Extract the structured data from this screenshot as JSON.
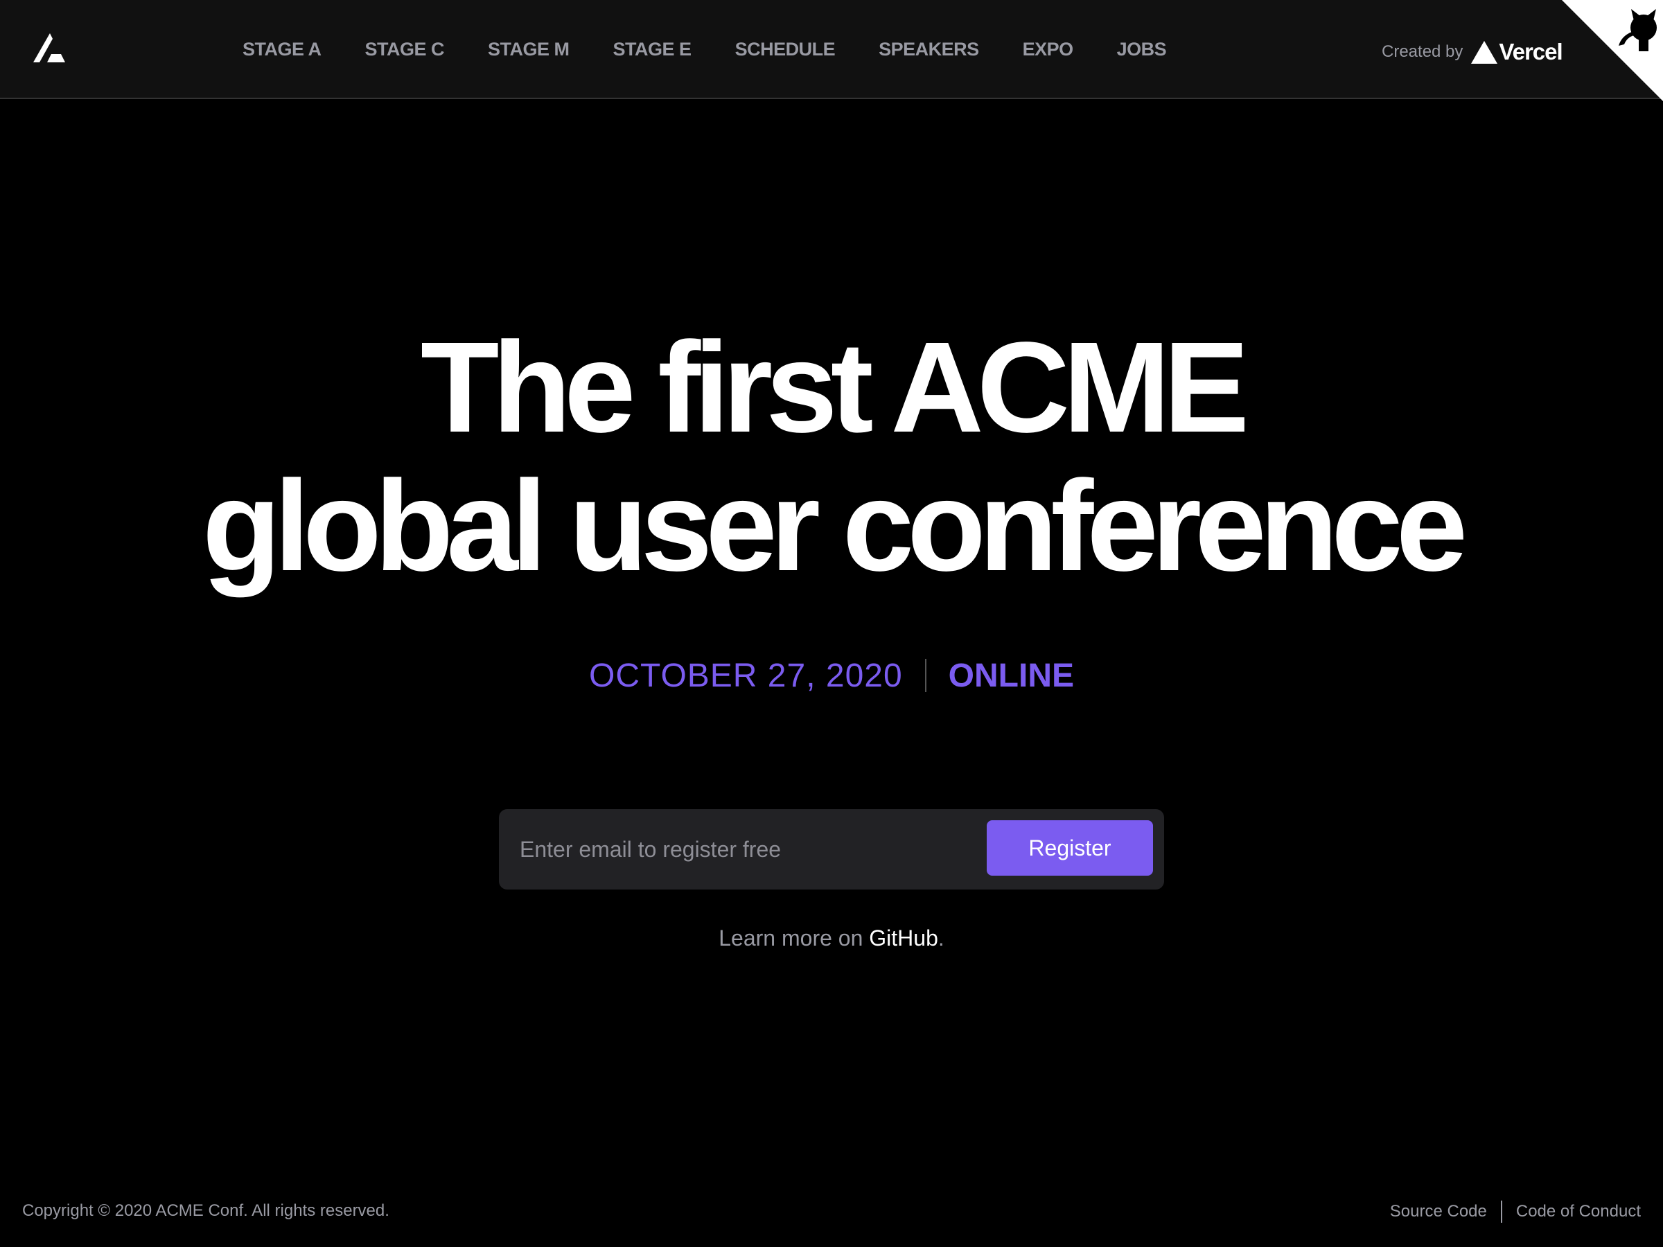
{
  "header": {
    "logo_icon": "acme-logo-icon",
    "nav": [
      {
        "label": "STAGE A"
      },
      {
        "label": "STAGE C"
      },
      {
        "label": "STAGE M"
      },
      {
        "label": "STAGE E"
      },
      {
        "label": "SCHEDULE"
      },
      {
        "label": "SPEAKERS"
      },
      {
        "label": "EXPO"
      },
      {
        "label": "JOBS"
      }
    ],
    "created_by_label": "Created by",
    "created_by_brand": "Vercel",
    "github_corner_icon": "github-octocat-icon"
  },
  "hero": {
    "title_line1": "The first ACME",
    "title_line2": "global user conference",
    "date": "OCTOBER 27, 2020",
    "location": "ONLINE"
  },
  "register": {
    "email_placeholder": "Enter email to register free",
    "email_value": "",
    "button_label": "Register"
  },
  "learn_more": {
    "prefix": "Learn more on ",
    "link_label": "GitHub",
    "suffix": "."
  },
  "footer": {
    "copyright": "Copyright © 2020 ACME Conf. All rights reserved.",
    "links": [
      {
        "label": "Source Code"
      },
      {
        "label": "Code of Conduct"
      }
    ]
  },
  "colors": {
    "background": "#000000",
    "header_background": "#111111",
    "accent": "#7b5cf0",
    "muted_text": "#999aa3",
    "input_background": "#222225"
  }
}
